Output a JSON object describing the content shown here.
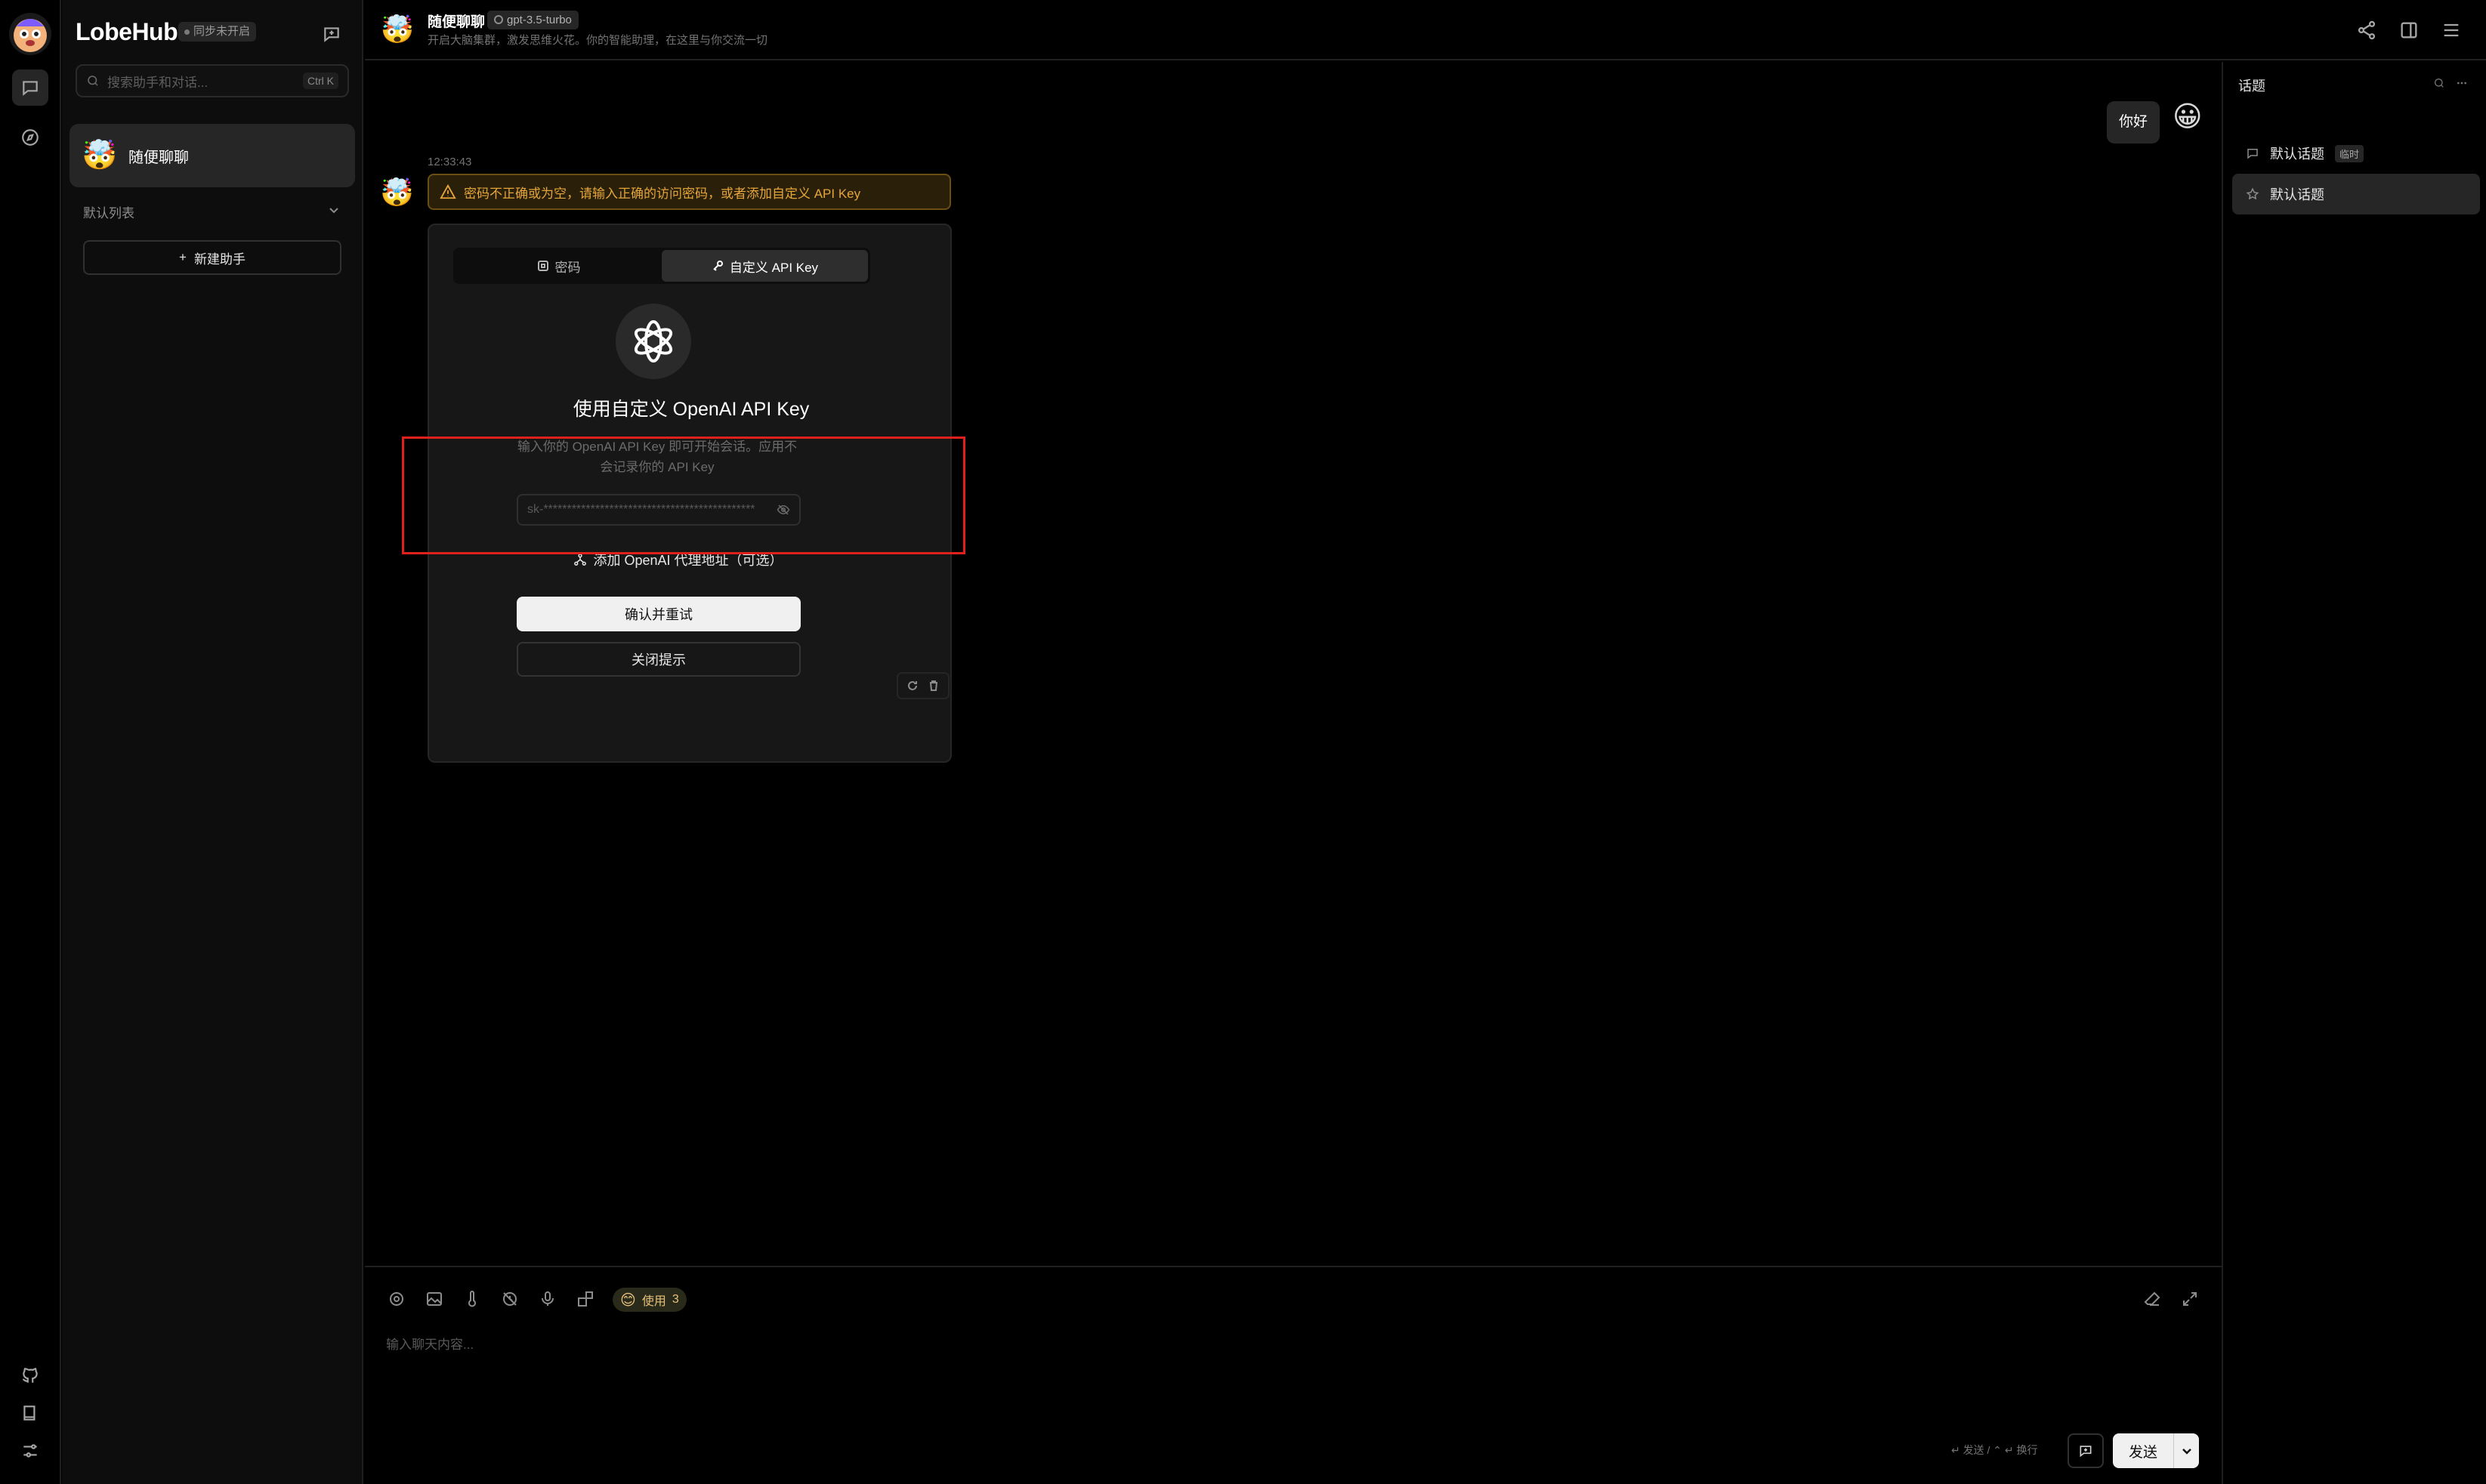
{
  "app": {
    "brand": "LobeHub",
    "sync_status": "同步未开启",
    "search_placeholder": "搜索助手和对话...",
    "search_shortcut": "Ctrl K"
  },
  "sidebar": {
    "sessions": [
      {
        "emoji": "🤯",
        "name": "随便聊聊"
      }
    ],
    "group_title": "默认列表",
    "new_assistant_label": "新建助手"
  },
  "header": {
    "emoji": "🤯",
    "title": "随便聊聊",
    "model": "gpt-3.5-turbo",
    "description": "开启大脑集群，激发思维火花。你的智能助理，在这里与你交流一切"
  },
  "chat": {
    "user_message": "你好",
    "user_emoji": "😀",
    "bot_emoji": "🤯",
    "timestamp": "12:33:43",
    "warning": "密码不正确或为空，请输入正确的访问密码，或者添加自定义 API Key",
    "tabs": [
      "密码",
      "自定义 API Key"
    ],
    "active_tab": 1,
    "card_title": "使用自定义 OpenAI API Key",
    "card_desc": "输入你的 OpenAI API Key 即可开始会话。应用不会记录你的 API Key",
    "key_placeholder": "sk-*********************************************",
    "proxy_label": "添加 OpenAI 代理地址（可选）",
    "confirm_label": "确认并重试",
    "close_label": "关闭提示"
  },
  "input": {
    "token_label": "使用",
    "token_count": "3",
    "token_emoji": "😊",
    "placeholder": "输入聊天内容...",
    "send_hint": "↵ 发送 / ⌃ ↵ 换行",
    "send_label": "发送"
  },
  "topics": {
    "title": "话题",
    "items": [
      {
        "label": "默认话题",
        "tag": "临时"
      },
      {
        "label": "默认话题",
        "tag": ""
      }
    ]
  },
  "colors": {
    "warning": "#e5a53a",
    "highlight_box": "#e0201c",
    "background": "#000000"
  }
}
